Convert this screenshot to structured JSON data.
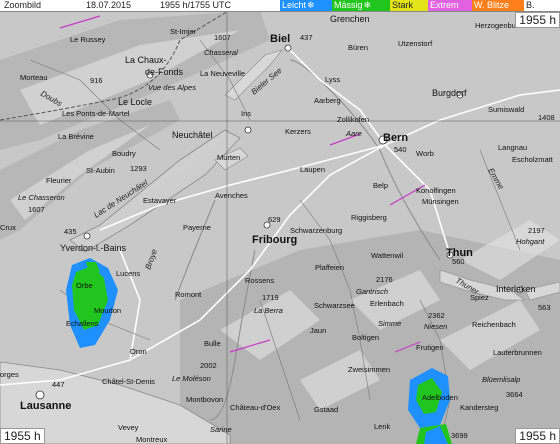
{
  "header": {
    "title": "Zoombild",
    "date": "18.07.2015",
    "time": "1955 h/1755 UTC"
  },
  "legend": [
    {
      "label": "Leicht",
      "bg": "#1e90ff",
      "fg": "#ffffff",
      "icon": "snowflake-icon"
    },
    {
      "label": "Mässig",
      "bg": "#22c51d",
      "fg": "#ffffff",
      "icon": "snowflake-icon"
    },
    {
      "label": "Stark",
      "bg": "#e3e31a",
      "fg": "#222222"
    },
    {
      "label": "Extrem",
      "bg": "#e062e0",
      "fg": "#ffffff"
    },
    {
      "label": "W. Blitze",
      "bg": "#ff7f1a",
      "fg": "#ffffff"
    },
    {
      "label": "B.",
      "bg": "#ffffff",
      "fg": "#222222"
    }
  ],
  "corners": {
    "top_right": "1955 h",
    "bottom_left": "1955 h",
    "bottom_right": "1955 h"
  },
  "places": {
    "grenchen": "Grenchen",
    "le_russey": "Le Russey",
    "st_imier": "St-Imier",
    "chasseral": "Chasseral",
    "chasseral_elev": "1607",
    "biel": "Biel",
    "bueren": "Büren",
    "utzenstorf": "Utzenstorf",
    "herzogenbuchsee": "Herzogenbuchsee",
    "morteau": "Morteau",
    "la_chaux": "La Chaux-",
    "de_fonds": "de-Fonds",
    "vue_des_alpes": "Vue des Alpes",
    "le_locle": "Le Locle",
    "la_neuveville": "La Neuveville",
    "lyss": "Lyss",
    "burgdorf": "Burgdorf",
    "les_ponts": "Les Ponts-de-Martel",
    "aarberg": "Aarberg",
    "zollikofen": "Zollikofen",
    "sumiswald": "Sumiswald",
    "la_brevine": "La Brévine",
    "neuchatel": "Neuchâtel",
    "ins": "Ins",
    "kerzers": "Kerzers",
    "bern": "Bern",
    "boudry": "Boudry",
    "murten": "Murten",
    "laupen": "Laupen",
    "worb": "Worb",
    "langnau": "Langnau",
    "escholzmatt": "Escholzmatt",
    "fleurier": "Fleurier",
    "st_aubin": "St-Aubin",
    "avenches": "Avenches",
    "belp": "Belp",
    "konolfingen": "Konolfingen",
    "muensingen": "Münsingen",
    "le_chasseron": "Le Chasseron",
    "chasseron_elev": "1607",
    "estavayer": "Estavayer",
    "lac_neuchatel": "Lac de Neuchâtel",
    "payerne": "Payerne",
    "riggisberg": "Riggisberg",
    "schwarzenburg": "Schwarzenburg",
    "fribourg": "Fribourg",
    "fribourg_elev": "629",
    "hohgant": "Hohgant",
    "hohgant_elev": "2197",
    "yverdon": "Yverdon-l.-Bains",
    "wattenwil": "Wattenwil",
    "thun": "Thun",
    "thun_elev": "560",
    "lucens": "Lucens",
    "plaffeien": "Plaffeien",
    "gantrisch": "Gantrisch",
    "gantrisch_elev": "2176",
    "romont": "Romont",
    "rossens": "Rossens",
    "orbe": "Orbe",
    "la_berra": "La Berra",
    "berra_elev": "1719",
    "spiez": "Spiez",
    "interlaken": "Interlaken",
    "echallens": "Echallens",
    "moudon": "Moudon",
    "schwarzsee": "Schwarzsee",
    "erlenbach": "Erlenbach",
    "simme": "Simme",
    "jaun": "Jaun",
    "niesen": "Niesen",
    "niesen_elev": "2362",
    "reichenbach": "Reichenbach",
    "bulle": "Bulle",
    "boltigen": "Boltigen",
    "lauterbrunnen": "Lauterbrunnen",
    "oron": "Oron",
    "zweisimmen": "Zweisimmen",
    "frutigen": "Frutigen",
    "morges": "Morges",
    "chatel": "Châtel-St-Denis",
    "le_moleson": "Le Moléson",
    "moleson_elev": "2002",
    "bluemlisalp": "Blüemlisalp",
    "lausanne": "Lausanne",
    "montbovon": "Montbovon",
    "adelboden": "Adelboden",
    "chateau_doex": "Château-d'Oex",
    "gstaad": "Gstaad",
    "lenk": "Lenk",
    "kandersteg": "Kandersteg",
    "kandersteg_elev": "3664",
    "vevey": "Vevey",
    "montreux": "Montreux",
    "sarine": "Sarine",
    "elev_3699": "3699",
    "emme": "Emme",
    "aare": "Aare",
    "doubs": "Doubs",
    "elev_916": "916",
    "elev_1293": "1293",
    "elev_437": "437",
    "elev_1408": "1408",
    "elev_540": "540",
    "elev_447": "447",
    "elev_563": "563",
    "broye": "Broye",
    "cruix": "Crux",
    "orges": "orges",
    "elev_435": "435",
    "thuner": "Thuner",
    "bieler_see": "Bieler See"
  }
}
